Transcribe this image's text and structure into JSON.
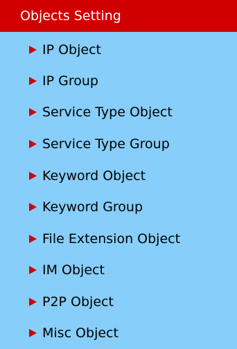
{
  "panel": {
    "title": "Objects Setting",
    "header_color": "#d10000",
    "background_color": "#87cefa",
    "arrow_color": "#d10000",
    "items": [
      {
        "label": "IP Object",
        "icon": "triangle-right-icon"
      },
      {
        "label": "IP Group",
        "icon": "triangle-right-icon"
      },
      {
        "label": "Service Type Object",
        "icon": "triangle-right-icon"
      },
      {
        "label": "Service Type Group",
        "icon": "triangle-right-icon"
      },
      {
        "label": "Keyword Object",
        "icon": "triangle-right-icon"
      },
      {
        "label": "Keyword Group",
        "icon": "triangle-right-icon"
      },
      {
        "label": "File Extension Object",
        "icon": "triangle-right-icon"
      },
      {
        "label": "IM Object",
        "icon": "triangle-right-icon"
      },
      {
        "label": "P2P Object",
        "icon": "triangle-right-icon"
      },
      {
        "label": "Misc Object",
        "icon": "triangle-right-icon"
      }
    ]
  }
}
